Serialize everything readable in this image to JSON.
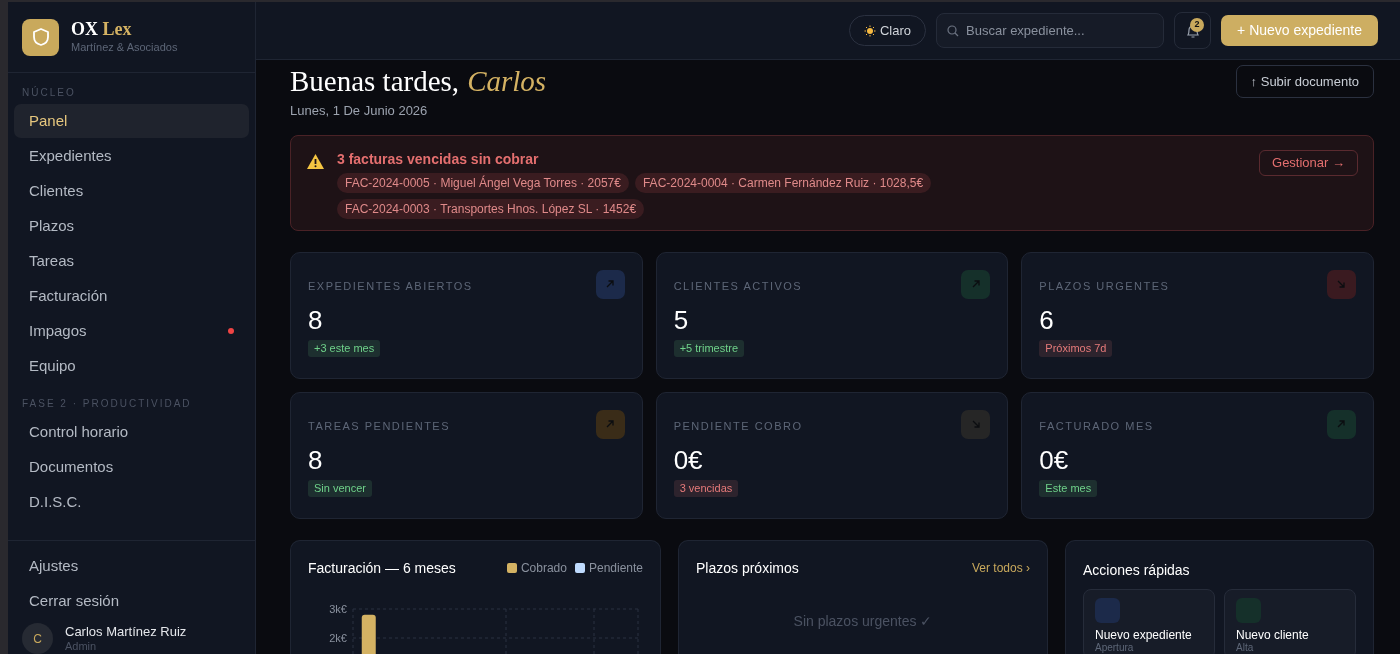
{
  "brand": {
    "name": "OX",
    "accent": "Lex",
    "subtitle": "Martínez & Asociados"
  },
  "sidebar": {
    "sections": [
      {
        "title": "NÚCLEO",
        "items": [
          {
            "label": "Panel",
            "selected": true,
            "alert": false
          },
          {
            "label": "Expedientes",
            "selected": false,
            "alert": false
          },
          {
            "label": "Clientes",
            "selected": false,
            "alert": false
          },
          {
            "label": "Plazos",
            "selected": false,
            "alert": false
          },
          {
            "label": "Tareas",
            "selected": false,
            "alert": false
          },
          {
            "label": "Facturación",
            "selected": false,
            "alert": false
          },
          {
            "label": "Impagos",
            "selected": false,
            "alert": true
          },
          {
            "label": "Equipo",
            "selected": false,
            "alert": false
          }
        ]
      },
      {
        "title": "FASE 2 · PRODUCTIVIDAD",
        "items": [
          {
            "label": "Control horario",
            "selected": false,
            "alert": false
          },
          {
            "label": "Documentos",
            "selected": false,
            "alert": false
          },
          {
            "label": "D.I.S.C.",
            "selected": false,
            "alert": false
          }
        ]
      }
    ],
    "footer_items": [
      "Ajustes",
      "Cerrar sesión"
    ],
    "user": {
      "initial": "C",
      "name": "Carlos Martínez Ruiz",
      "role": "Admin"
    }
  },
  "header": {
    "theme_button": "Claro",
    "search": {
      "placeholder": "Buscar expediente..."
    },
    "notifications": "2",
    "primary_button": "+ Nuevo expediente"
  },
  "greeting": {
    "text": "Buenas tardes,",
    "name": "Carlos",
    "date": "Lunes, 1 De Junio 2026",
    "upload_button": "↑ Subir documento"
  },
  "alert": {
    "title": "3 facturas vencidas sin cobrar",
    "tags": [
      "FAC-2024-0005 · Miguel Ángel Vega Torres · 2057€",
      "FAC-2024-0004 · Carmen Fernández Ruiz · 1028,5€",
      "FAC-2024-0003 · Transportes Hnos. López SL · 1452€"
    ],
    "button": "Gestionar →"
  },
  "stats": [
    {
      "label": "EXPEDIENTES ABIERTOS",
      "value": "8",
      "badge": {
        "text": "+3 este mes",
        "color": "#6fd28a"
      },
      "icon": {
        "kind": "up",
        "color": "#1c2a4a"
      }
    },
    {
      "label": "CLIENTES ACTIVOS",
      "value": "5",
      "badge": {
        "text": "+5 trimestre",
        "color": "#6fd28a"
      },
      "icon": {
        "kind": "up",
        "color": "#15302a"
      }
    },
    {
      "label": "PLAZOS URGENTES",
      "value": "6",
      "badge": {
        "text": "Próximos 7d",
        "color": "#e67a7a"
      },
      "icon": {
        "kind": "down",
        "color": "#3a1a20"
      }
    },
    {
      "label": "TAREAS PENDIENTES",
      "value": "8",
      "badge": {
        "text": "Sin vencer",
        "color": "#6fd28a"
      },
      "icon": {
        "kind": "up",
        "color": "#3a2c18"
      }
    },
    {
      "label": "PENDIENTE COBRO",
      "value": "0€",
      "badge": {
        "text": "3 vencidas",
        "color": "#e67a7a"
      },
      "icon": {
        "kind": "down",
        "color": "#262626"
      }
    },
    {
      "label": "FACTURADO MES",
      "value": "0€",
      "badge": {
        "text": "Este mes",
        "color": "#6fd28a"
      },
      "icon": {
        "kind": "up",
        "color": "#15302a"
      }
    }
  ],
  "billing_chart": {
    "title": "Facturación — 6 meses",
    "chart_data": {
      "type": "bar",
      "ylim": [
        0,
        3000
      ],
      "yticks": [
        {
          "value": 2000,
          "label": "2k€"
        },
        {
          "value": 3000,
          "label": "3k€"
        }
      ],
      "series": [
        {
          "name": "Cobrado",
          "color": "#d4b263",
          "values": [
            2800,
            0,
            0,
            0,
            0,
            0
          ]
        },
        {
          "name": "Pendiente",
          "color": "#bfdbfe",
          "values": [
            0,
            0,
            0,
            0,
            0,
            0
          ]
        }
      ]
    }
  },
  "deadlines": {
    "title": "Plazos próximos",
    "link": "Ver todos ›",
    "empty": "Sin plazos urgentes ✓"
  },
  "quick_actions": {
    "title": "Acciones rápidas",
    "items": [
      {
        "label": "Nuevo expediente",
        "sub": "Apertura",
        "icon": {
          "color": "#1c2a4a"
        }
      },
      {
        "label": "Nuevo cliente",
        "sub": "Alta",
        "icon": {
          "color": "#15302a"
        }
      }
    ]
  }
}
